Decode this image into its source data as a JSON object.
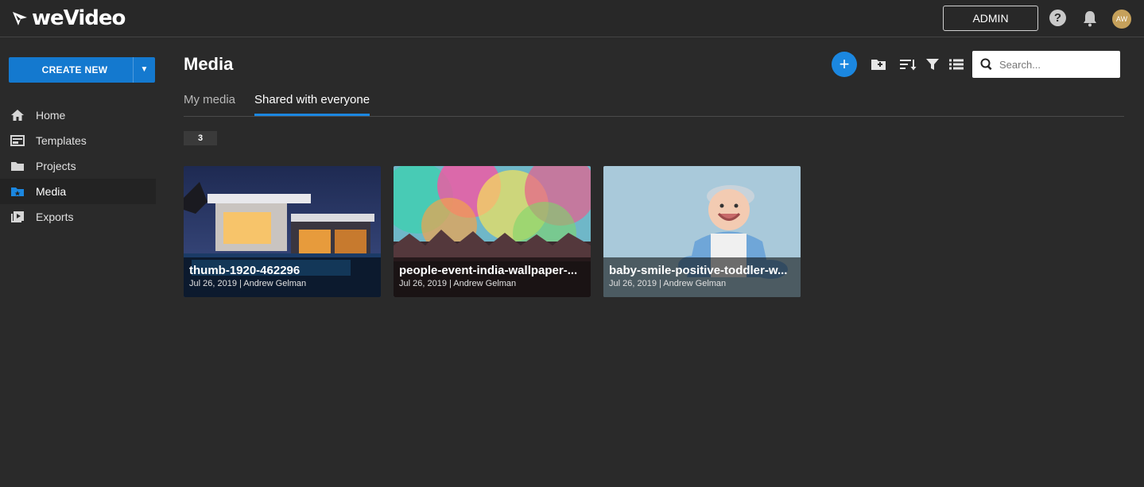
{
  "app": {
    "logo_text": "weVideo",
    "admin_label": "ADMIN",
    "help_glyph": "?",
    "avatar_initials": "AW",
    "accent_color": "#1479cf"
  },
  "sidebar": {
    "create_label": "CREATE NEW",
    "create_caret": "⌄",
    "items": [
      {
        "label": "Home",
        "icon": "home-icon"
      },
      {
        "label": "Templates",
        "icon": "templates-icon"
      },
      {
        "label": "Projects",
        "icon": "folder-icon"
      },
      {
        "label": "Media",
        "icon": "media-icon",
        "active": true
      },
      {
        "label": "Exports",
        "icon": "exports-icon"
      }
    ]
  },
  "main": {
    "title": "Media",
    "search_placeholder": "Search...",
    "tabs": [
      {
        "label": "My media",
        "active": false
      },
      {
        "label": "Shared with everyone",
        "active": true
      }
    ],
    "count": "3",
    "cards": [
      {
        "title": "thumb-1920-462296",
        "meta": "Jul 26, 2019 | Andrew Gelman",
        "thumb": "house-night"
      },
      {
        "title": "people-event-india-wallpaper-...",
        "meta": "Jul 26, 2019 | Andrew Gelman",
        "thumb": "color-festival"
      },
      {
        "title": "baby-smile-positive-toddler-w...",
        "meta": "Jul 26, 2019 | Andrew Gelman",
        "thumb": "baby"
      }
    ]
  }
}
